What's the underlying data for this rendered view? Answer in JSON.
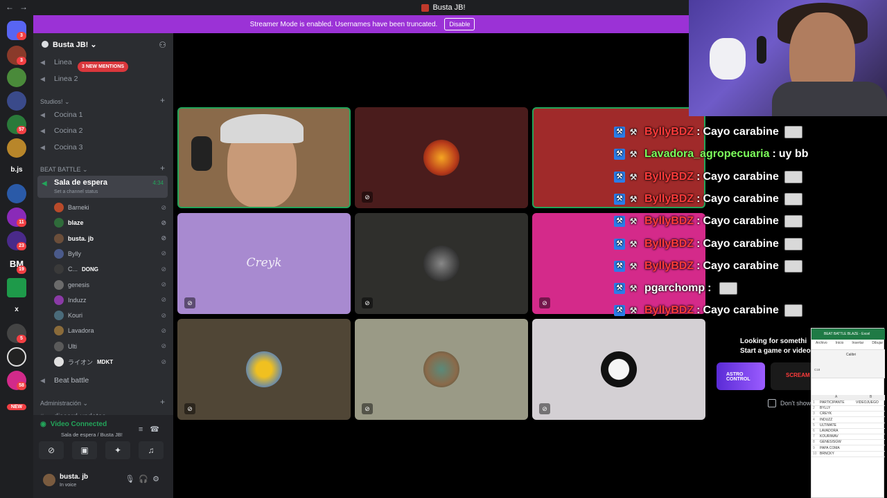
{
  "window": {
    "title": "Busta JB!"
  },
  "banner": {
    "text": "Streamer Mode is enabled. Usernames have been truncated.",
    "button": "Disable"
  },
  "guilds": {
    "text_items": [
      "b.js",
      "BM",
      "x",
      "NEW"
    ],
    "badges": [
      "3",
      "3",
      "57",
      "11",
      "23",
      "19",
      "5",
      "58"
    ]
  },
  "server": {
    "name": "Busta JB!"
  },
  "channels": {
    "mentions_pill": "3 NEW MENTIONS",
    "linea1": "Linea",
    "linea2": "Linea 2",
    "cat_studios": "Studios!",
    "cocina1": "Cocina 1",
    "cocina2": "Cocina 2",
    "cocina3": "Cocina 3",
    "cat_beatbattle": "BEAT BATTLE",
    "active": {
      "name": "Sala de espera",
      "status": "Set a channel status",
      "time": "4:34"
    },
    "beat_battle": "Beat battle",
    "cat_admin": "Administración",
    "discord_updates": "discord-updates"
  },
  "voice_users": [
    {
      "name": "Barneki",
      "color": "#b84a2a",
      "bright": false
    },
    {
      "name": "blaze",
      "color": "#2f6b3a",
      "bright": true
    },
    {
      "name": "busta. jb",
      "color": "#6b4e3a",
      "bright": true
    },
    {
      "name": "Bylly",
      "color": "#4a5a8a",
      "bright": false
    },
    {
      "name": "C...",
      "color": "#3a3a3a",
      "bright": false,
      "extra": "DONG"
    },
    {
      "name": "genesis",
      "color": "#6b6b6b",
      "bright": false
    },
    {
      "name": "Induzz",
      "color": "#8a3aa6",
      "bright": false
    },
    {
      "name": "Kouri",
      "color": "#4a6b7a",
      "bright": false
    },
    {
      "name": "Lavadora",
      "color": "#8a6b3a",
      "bright": false
    },
    {
      "name": "Ulti",
      "color": "#5a5a5a",
      "bright": false
    },
    {
      "name": "ライオン",
      "color": "#e0e0e0",
      "bright": false,
      "extra": "MDKT"
    }
  ],
  "voice_panel": {
    "status": "Video Connected",
    "sub": "Sala de espera / Busta JB!"
  },
  "user": {
    "name": "busta. jb",
    "status": "In voice"
  },
  "tiles": {
    "creyk_label": "Creyk"
  },
  "chat": [
    {
      "user": "ByllyBDZ",
      "sep": ":",
      "msg": "Cayo carabine",
      "green": false,
      "emote": true
    },
    {
      "user": "Lavadora_agropecuaria",
      "sep": ":",
      "msg": "uy bb",
      "green": true,
      "emote": false
    },
    {
      "user": "ByllyBDZ",
      "sep": ":",
      "msg": "Cayo carabine",
      "green": false,
      "emote": true
    },
    {
      "user": "ByllyBDZ",
      "sep": ":",
      "msg": "Cayo carabine",
      "green": false,
      "emote": true
    },
    {
      "user": "ByllyBDZ",
      "sep": ":",
      "msg": "Cayo carabine",
      "green": false,
      "emote": true
    },
    {
      "user": "ByllyBDZ",
      "sep": ":",
      "msg": "Cayo carabine",
      "green": false,
      "emote": true
    },
    {
      "user": "ByllyBDZ",
      "sep": ":",
      "msg": "Cayo carabine",
      "green": false,
      "emote": true
    },
    {
      "user": "pgarchomp",
      "sep": ":",
      "msg": "",
      "green": false,
      "white": true,
      "emote": true
    },
    {
      "user": "ByllyBDZ",
      "sep": ":",
      "msg": "Cayo carabine",
      "green": false,
      "emote": true
    }
  ],
  "activity": {
    "heading": "Looking for somethi",
    "heading2": "Start a game or video pla",
    "card1": "ASTRO CONTROL",
    "card2": "SCREAM",
    "checkbox": "Don't show"
  },
  "sheet": {
    "title": "BEAT BATTLE BLAZE - Excel",
    "menu": [
      "Archivo",
      "Inicio",
      "Insertar",
      "Dibujar"
    ],
    "font": "Calibri",
    "cell": "C18",
    "col_a": "A",
    "col_b": "B",
    "rows": [
      [
        "1",
        "PARTICIPANTE",
        "VIDEOJUEGO"
      ],
      [
        "2",
        "BYLLY",
        ""
      ],
      [
        "3",
        "CREYK",
        ""
      ],
      [
        "4",
        "INDUZZ",
        ""
      ],
      [
        "5",
        "ULTIMATE",
        ""
      ],
      [
        "6",
        "LAVADORA",
        ""
      ],
      [
        "7",
        "KOURIWAV",
        ""
      ],
      [
        "8",
        "GENESISGW",
        ""
      ],
      [
        "9",
        "PAPA COMA",
        ""
      ],
      [
        "10",
        "BRNCKY",
        ""
      ]
    ]
  }
}
